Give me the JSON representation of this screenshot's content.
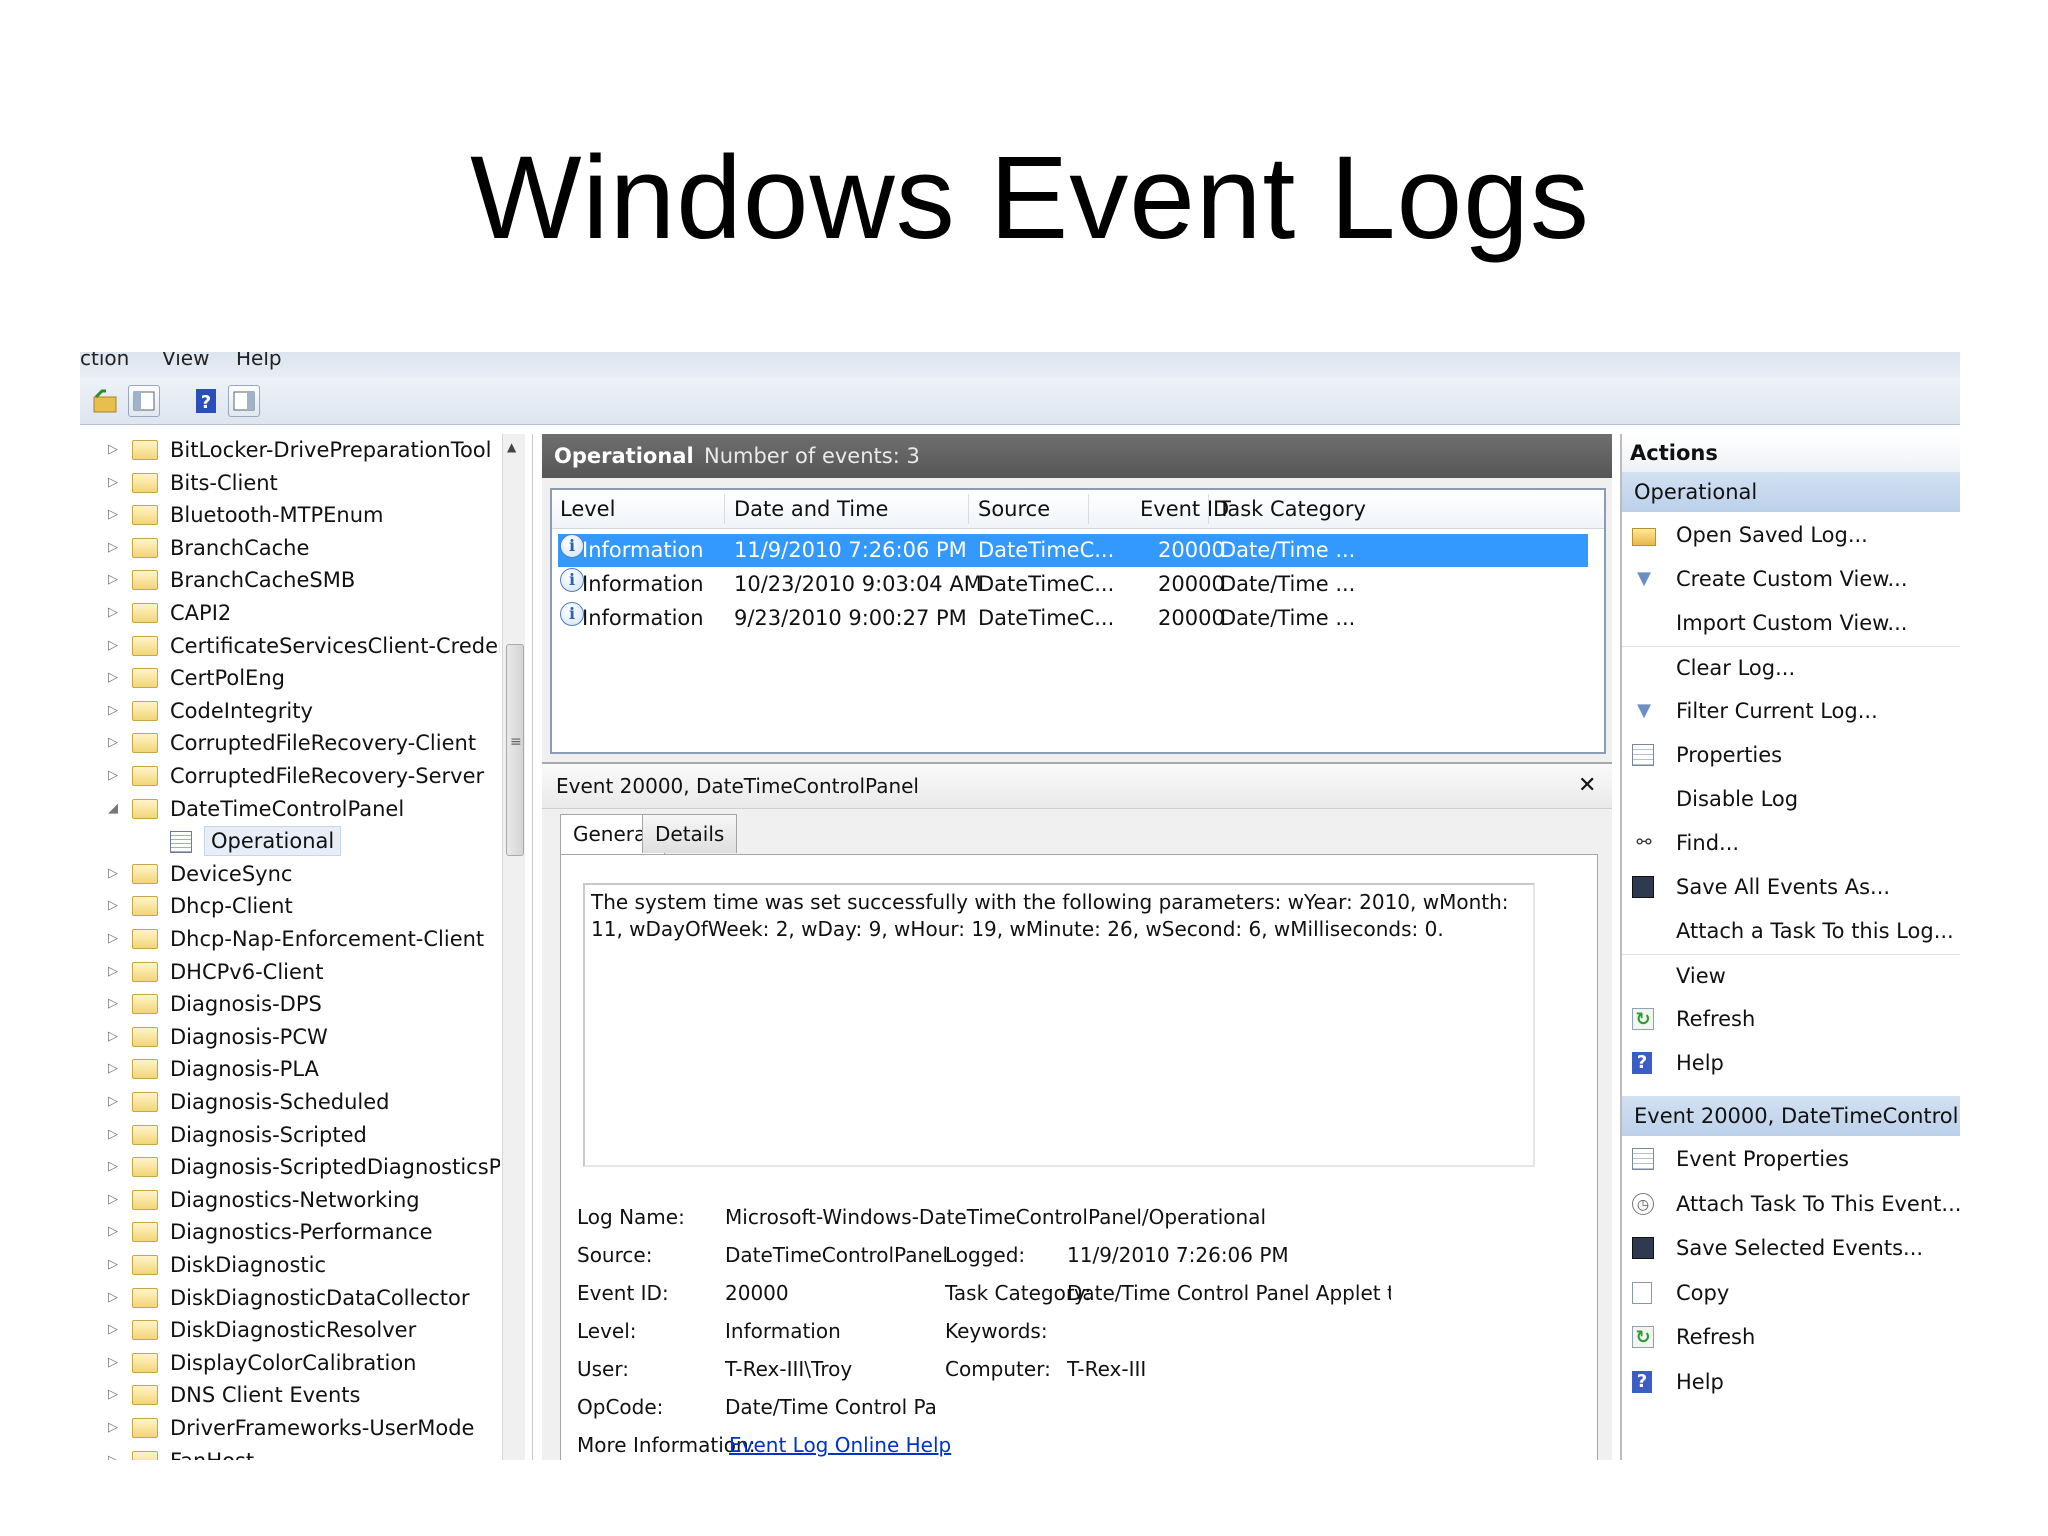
{
  "slide_title": "Windows Event Logs",
  "menu": {
    "action": "ction",
    "view": "View",
    "help": "Help"
  },
  "toolbar": {
    "icons": [
      "open-folder-icon",
      "show-hide-tree-icon",
      "help-icon",
      "show-hide-action-pane-icon"
    ]
  },
  "tree": {
    "items": [
      "BitLocker-DrivePreparationTool",
      "Bits-Client",
      "Bluetooth-MTPEnum",
      "BranchCache",
      "BranchCacheSMB",
      "CAPI2",
      "CertificateServicesClient-Credentia",
      "CertPolEng",
      "CodeIntegrity",
      "CorruptedFileRecovery-Client",
      "CorruptedFileRecovery-Server",
      "DateTimeControlPanel",
      "Operational",
      "DeviceSync",
      "Dhcp-Client",
      "Dhcp-Nap-Enforcement-Client",
      "DHCPv6-Client",
      "Diagnosis-DPS",
      "Diagnosis-PCW",
      "Diagnosis-PLA",
      "Diagnosis-Scheduled",
      "Diagnosis-Scripted",
      "Diagnosis-ScriptedDiagnosticsProv",
      "Diagnostics-Networking",
      "Diagnostics-Performance",
      "DiskDiagnostic",
      "DiskDiagnosticDataCollector",
      "DiskDiagnosticResolver",
      "DisplayColorCalibration",
      "DNS Client Events",
      "DriverFrameworks-UserMode",
      "FanHost"
    ]
  },
  "log": {
    "name": "Operational",
    "count_text": "Number of events: 3",
    "columns": [
      "Level",
      "Date and Time",
      "Source",
      "Event ID",
      "Task Category"
    ],
    "rows": [
      {
        "level": "Information",
        "datetime": "11/9/2010 7:26:06 PM",
        "source": "DateTimeC...",
        "event_id": "20000",
        "task": "Date/Time ..."
      },
      {
        "level": "Information",
        "datetime": "10/23/2010 9:03:04 AM",
        "source": "DateTimeC...",
        "event_id": "20000",
        "task": "Date/Time ..."
      },
      {
        "level": "Information",
        "datetime": "9/23/2010 9:00:27 PM",
        "source": "DateTimeC...",
        "event_id": "20000",
        "task": "Date/Time ..."
      }
    ]
  },
  "detail": {
    "title": "Event 20000, DateTimeControlPanel",
    "close": "✕",
    "tabs": [
      "General",
      "Details"
    ],
    "description": "The system time was set successfully with the following parameters: wYear: 2010, wMonth: 11, wDayOfWeek: 2, wDay: 9, wHour: 19, wMinute: 26, wSecond: 6, wMilliseconds: 0.",
    "labels": {
      "log_name": "Log Name:",
      "source": "Source:",
      "event_id": "Event ID:",
      "level": "Level:",
      "user": "User:",
      "opcode": "OpCode:",
      "more_info": "More Information:",
      "logged": "Logged:",
      "task_category": "Task Category:",
      "keywords": "Keywords:",
      "computer": "Computer:"
    },
    "values": {
      "log_name": "Microsoft-Windows-DateTimeControlPanel/Operational",
      "source": "DateTimeControlPanel",
      "event_id": "20000",
      "level": "Information",
      "user": "T-Rex-III\\Troy",
      "opcode": "Date/Time Control Panel Ap",
      "more_info_link": "Event Log Online Help",
      "logged": "11/9/2010 7:26:06 PM",
      "task_category": "Date/Time Control Panel Applet ti",
      "keywords": "",
      "computer": "T-Rex-III"
    }
  },
  "actions": {
    "title": "Actions",
    "section1": "Operational",
    "items1": [
      {
        "label": "Open Saved Log...",
        "icon": "open-folder-icon"
      },
      {
        "label": "Create Custom View...",
        "icon": "filter-icon"
      },
      {
        "label": "Import Custom View...",
        "icon": ""
      },
      {
        "label": "Clear Log...",
        "icon": ""
      },
      {
        "label": "Filter Current Log...",
        "icon": "filter-icon"
      },
      {
        "label": "Properties",
        "icon": "properties-icon"
      },
      {
        "label": "Disable Log",
        "icon": ""
      },
      {
        "label": "Find...",
        "icon": "binoculars-icon"
      },
      {
        "label": "Save All Events As...",
        "icon": "save-icon"
      },
      {
        "label": "Attach a Task To this Log...",
        "icon": ""
      },
      {
        "label": "View",
        "icon": ""
      },
      {
        "label": "Refresh",
        "icon": "refresh-icon"
      },
      {
        "label": "Help",
        "icon": "help-icon"
      }
    ],
    "section2": "Event 20000, DateTimeControlPanel",
    "items2": [
      {
        "label": "Event Properties",
        "icon": "properties-icon"
      },
      {
        "label": "Attach Task To This Event...",
        "icon": "task-clock-icon"
      },
      {
        "label": "Save Selected Events...",
        "icon": "save-icon"
      },
      {
        "label": "Copy",
        "icon": "copy-icon"
      },
      {
        "label": "Refresh",
        "icon": "refresh-icon"
      },
      {
        "label": "Help",
        "icon": "help-icon"
      }
    ]
  }
}
